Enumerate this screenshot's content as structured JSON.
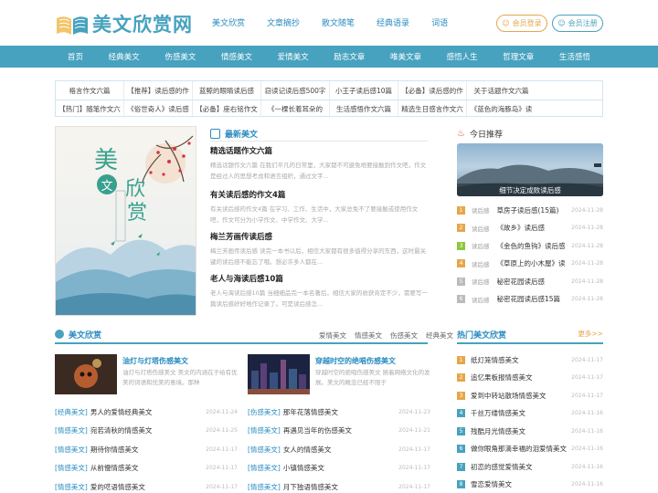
{
  "logo": {
    "text": "美文欣赏网"
  },
  "topnav": [
    "美文欣赏",
    "文章摘抄",
    "散文随笔",
    "经典语录",
    "词语"
  ],
  "buttons": {
    "login": "会员登录",
    "register": "会员注册"
  },
  "mainnav": [
    "首页",
    "经典美文",
    "伤感美文",
    "情感美文",
    "爱情美文",
    "励志文章",
    "唯美文章",
    "感悟人生",
    "哲理文章",
    "生活感悟"
  ],
  "linkgrid": [
    [
      "格言作文六篇",
      "【推荐】读后感的作",
      "蓝鲸的眼睛读后感",
      "窃读记读后感500字",
      "小王子读后感10篇",
      "【必备】读后感的作",
      "关于话题作文六篇"
    ],
    [
      "【热门】随笔作文六",
      "《俗世奇人》读后感",
      "【必备】座右铭作文",
      "《一棵长着耳朵的",
      "生活感悟作文六篇",
      "精选生日感言作文六",
      "《蓝色的海豚岛》读"
    ]
  ],
  "cover": {
    "title1": "美",
    "title2": "文",
    "title3": "欣",
    "title4": "赏"
  },
  "latest": {
    "heading": "最新美文",
    "articles": [
      {
        "title": "精选话题作文六篇",
        "desc": "精选话题作文六篇 在我们平凡的日常里，大家都不可避免地要接触到作文吧，作文是经过人的思想考虑和语言组织，通过文字..."
      },
      {
        "title": "有关读后感的作文4篇",
        "desc": "有关读后感的作文4篇 在学习、工作、生活中，大家总免不了要接触或使用作文吧，作文可分为小学作文、中学作文、大学..."
      },
      {
        "title": "梅兰芳画传读后感",
        "desc": "梅兰芳画传读后感 读完一本书以后，相信大家都有很多值得分享的东西，这时最关键的读后感不能忘了哦。想必许多人都在..."
      },
      {
        "title": "老人与海读后感10篇",
        "desc": "老人与海读后感10篇 当细细品完一本名著后，相信大家的收获肯定不少，需要写一篇读后感好好地作记录了。可是读后感怎..."
      }
    ]
  },
  "today": {
    "heading": "今日推荐",
    "caption": "细节决定成败读后感",
    "items": [
      {
        "n": "1",
        "tag": "读后感",
        "title": "草房子读后感(15篇)",
        "date": "2024-11-28",
        "color": "#e6a64a"
      },
      {
        "n": "2",
        "tag": "读后感",
        "title": "《故乡》读后感",
        "date": "2024-11-28",
        "color": "#e6a64a"
      },
      {
        "n": "3",
        "tag": "读后感",
        "title": "《金色的鱼钩》读后感",
        "date": "2024-11-28",
        "color": "#8cc63f"
      },
      {
        "n": "4",
        "tag": "读后感",
        "title": "《草原上的小木屋》读",
        "date": "2024-11-28",
        "color": "#e6a64a"
      },
      {
        "n": "5",
        "tag": "读后感",
        "title": "秘密花园读后感",
        "date": "2024-11-28",
        "color": "#bbbbbb"
      },
      {
        "n": "6",
        "tag": "读后感",
        "title": "秘密花园读后感15篇",
        "date": "2024-11-28",
        "color": "#bbbbbb"
      }
    ]
  },
  "section": {
    "title": "美文欣赏",
    "tabs": [
      "爱情美文",
      "情感美文",
      "伤感美文",
      "经典美文"
    ]
  },
  "feature_left": {
    "title": "油灯与灯塔伤感美文",
    "desc": "油灯与灯塔伤感美文 美文的内涵在于给有优美的词语和优美的意境。那种"
  },
  "feature_right": {
    "title": "穿越时空的绝唱伤感美文",
    "desc": "穿越时空的绝唱伤感美文 随着网络文化的发展。美文的概念已经不限于"
  },
  "list_left": [
    {
      "cat": "[经典美文]",
      "title": "男人的爱情经典美文",
      "date": "2024-11-24"
    },
    {
      "cat": "[情感美文]",
      "title": "宛若清秋的情感美文",
      "date": "2024-11-25"
    },
    {
      "cat": "[情感美文]",
      "title": "期待你情感美文",
      "date": "2024-11-17"
    },
    {
      "cat": "[情感美文]",
      "title": "从前慢情感美文",
      "date": "2024-11-17"
    },
    {
      "cat": "[情感美文]",
      "title": "爱的呓语情感美文",
      "date": "2024-11-17"
    }
  ],
  "list_right": [
    {
      "cat": "[伤感美文]",
      "title": "那年花落情感美文",
      "date": "2024-11-23"
    },
    {
      "cat": "[情感美文]",
      "title": "再遇见当年的伤感美文",
      "date": "2024-11-21"
    },
    {
      "cat": "[情感美文]",
      "title": "女人的情感美文",
      "date": "2024-11-17"
    },
    {
      "cat": "[情感美文]",
      "title": "小镇情感美文",
      "date": "2024-11-17"
    },
    {
      "cat": "[情感美文]",
      "title": "月下独语情感美文",
      "date": "2024-11-17"
    }
  ],
  "hot": {
    "title": "热门美文欣赏",
    "more": "更多>>",
    "items": [
      {
        "n": "1",
        "title": "纸灯笼情感美文",
        "date": "2024-11-17",
        "color": "#e6a64a"
      },
      {
        "n": "2",
        "title": "追忆果板报情感美文",
        "date": "2024-11-17",
        "color": "#e6a64a"
      },
      {
        "n": "3",
        "title": "爱到中转站散场情感美文",
        "date": "2024-11-17",
        "color": "#e6a64a"
      },
      {
        "n": "4",
        "title": "千丝万缕情感美文",
        "date": "2024-11-16",
        "color": "#47a2bf"
      },
      {
        "n": "5",
        "title": "残酷月光情感美文",
        "date": "2024-11-16",
        "color": "#47a2bf"
      },
      {
        "n": "6",
        "title": "做你眼角那滴幸福的泪爱情美文",
        "date": "2024-11-16",
        "color": "#47a2bf"
      },
      {
        "n": "7",
        "title": "初恋的感觉爱情美文",
        "date": "2024-11-16",
        "color": "#47a2bf"
      },
      {
        "n": "8",
        "title": "雪恋爱情美文",
        "date": "2024-11-16",
        "color": "#47a2bf"
      }
    ]
  }
}
